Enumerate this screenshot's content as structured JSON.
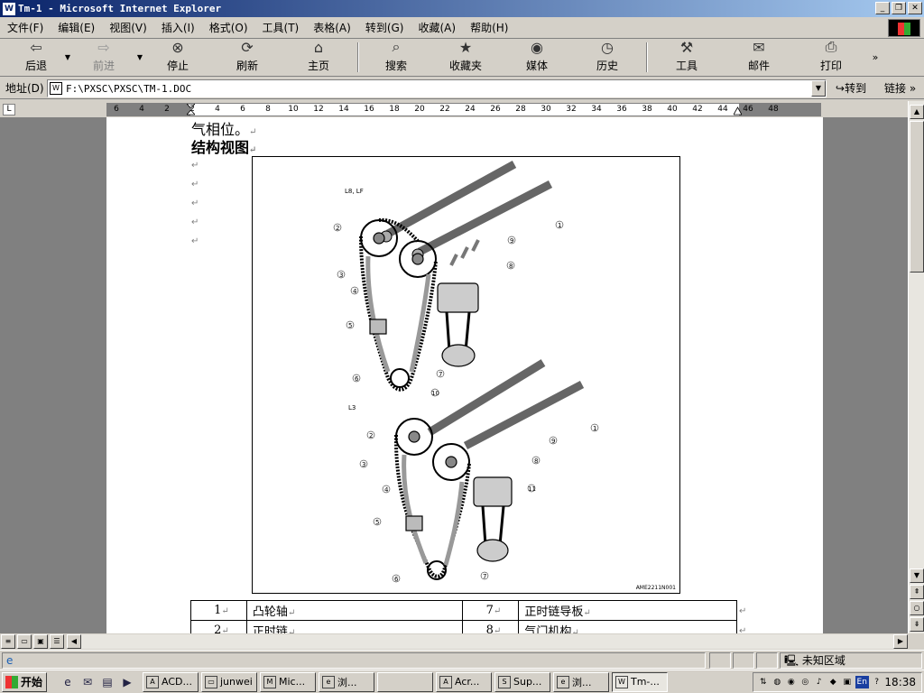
{
  "window": {
    "title": "Tm-1 - Microsoft Internet Explorer"
  },
  "menu": [
    "文件(F)",
    "编辑(E)",
    "视图(V)",
    "插入(I)",
    "格式(O)",
    "工具(T)",
    "表格(A)",
    "转到(G)",
    "收藏(A)",
    "帮助(H)"
  ],
  "toolbar": {
    "back": "后退",
    "forward": "前进",
    "stop": "停止",
    "refresh": "刷新",
    "home": "主页",
    "search": "搜索",
    "favorites": "收藏夹",
    "media": "媒体",
    "history": "历史",
    "tools": "工具",
    "mail": "邮件",
    "print": "打印"
  },
  "address": {
    "label": "地址(D)",
    "value": "F:\\PXSC\\PXSC\\TM-1.DOC",
    "go": "转到",
    "links": "链接"
  },
  "ruler": {
    "ticks": [
      "6",
      "4",
      "2",
      "2",
      "4",
      "6",
      "8",
      "10",
      "12",
      "14",
      "16",
      "18",
      "20",
      "22",
      "24",
      "26",
      "28",
      "30",
      "32",
      "34",
      "36",
      "38",
      "40",
      "42",
      "44",
      "46",
      "48"
    ]
  },
  "document": {
    "line1": "气相位。",
    "heading": "结构视图",
    "figure": {
      "top_label": "L8, LF",
      "bottom_label": "L3",
      "code": "AME2211N001",
      "callouts_top": [
        "1",
        "2",
        "3",
        "4",
        "5",
        "6",
        "7",
        "8",
        "9"
      ],
      "callouts_bottom": [
        "1",
        "2",
        "3",
        "4",
        "5",
        "6",
        "7",
        "8",
        "9",
        "10",
        "11"
      ]
    },
    "table": [
      {
        "n1": "1",
        "t1": "凸轮轴",
        "n2": "7",
        "t2": "正时链导板"
      },
      {
        "n1": "2",
        "t1": "正时链",
        "n2": "8",
        "t2": "气门机构"
      }
    ]
  },
  "status": {
    "zone": "未知区域"
  },
  "taskbar": {
    "start": "开始",
    "tasks": [
      "ACD...",
      "junwei",
      "Mic...",
      "浏...",
      "",
      "Acr...",
      "Sup...",
      "浏...",
      "Tm-..."
    ],
    "clock": "18:38",
    "lang": "En"
  }
}
